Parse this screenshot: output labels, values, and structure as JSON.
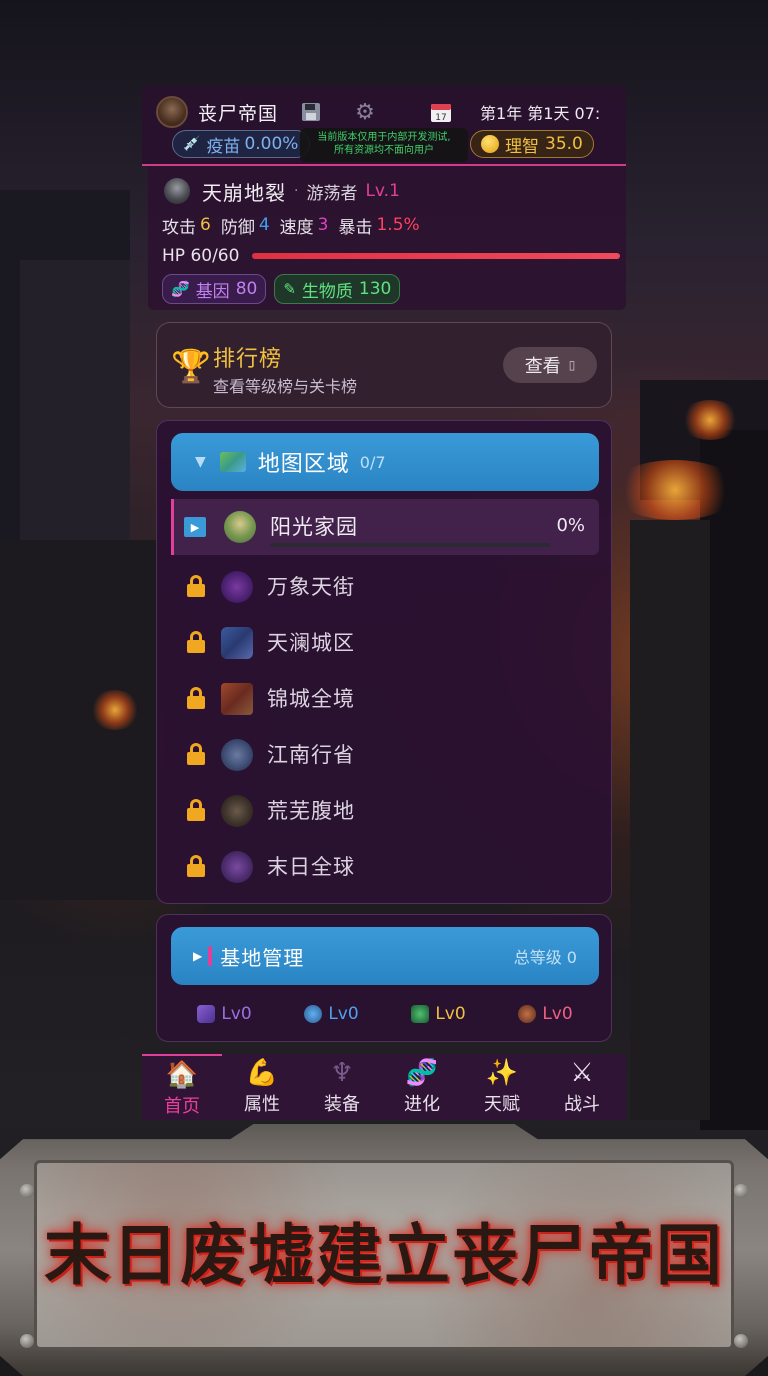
{
  "header": {
    "empire_name": "丧尸帝国",
    "date": "第1年 第1天 07:",
    "vaccine_label": "疫苗",
    "vaccine_value": "0.00%",
    "notice_line1": "当前版本仅用于内部开发测试,",
    "notice_line2": "所有资源均不面向用户",
    "reason_label": "理智",
    "reason_value": "35.0"
  },
  "player": {
    "name": "天崩地裂",
    "title": "游荡者",
    "level": "Lv.1",
    "stats": {
      "attack_label": "攻击",
      "attack": "6",
      "defense_label": "防御",
      "defense": "4",
      "speed_label": "速度",
      "speed": "3",
      "crit_label": "暴击",
      "crit": "1.5%"
    },
    "hp_text": "HP 60/60",
    "hp_fraction": 1.0,
    "gene_label": "基因",
    "gene": "80",
    "bio_label": "生物质",
    "bio": "130"
  },
  "leaderboard": {
    "title": "排行榜",
    "subtitle": "查看等级榜与关卡榜",
    "button": "查看"
  },
  "map_regions": {
    "title": "地图区域",
    "count": "0/7",
    "active": {
      "name": "阳光家园",
      "progress": "0%"
    },
    "locked": [
      "万象天街",
      "天澜城区",
      "锦城全境",
      "江南行省",
      "荒芜腹地",
      "末日全球"
    ]
  },
  "base": {
    "title": "基地管理",
    "total": "总等级 0",
    "levels": [
      "Lv0",
      "Lv0",
      "Lv0",
      "Lv0"
    ]
  },
  "tabs": [
    "首页",
    "属性",
    "装备",
    "进化",
    "天赋",
    "战斗"
  ],
  "banner": {
    "text": "末日废墟建立丧尸帝国"
  },
  "colors": {
    "accent": "#e0409a",
    "panel": "#2a1032",
    "header_blue": "#2a84c4",
    "gold": "#f0c040"
  }
}
